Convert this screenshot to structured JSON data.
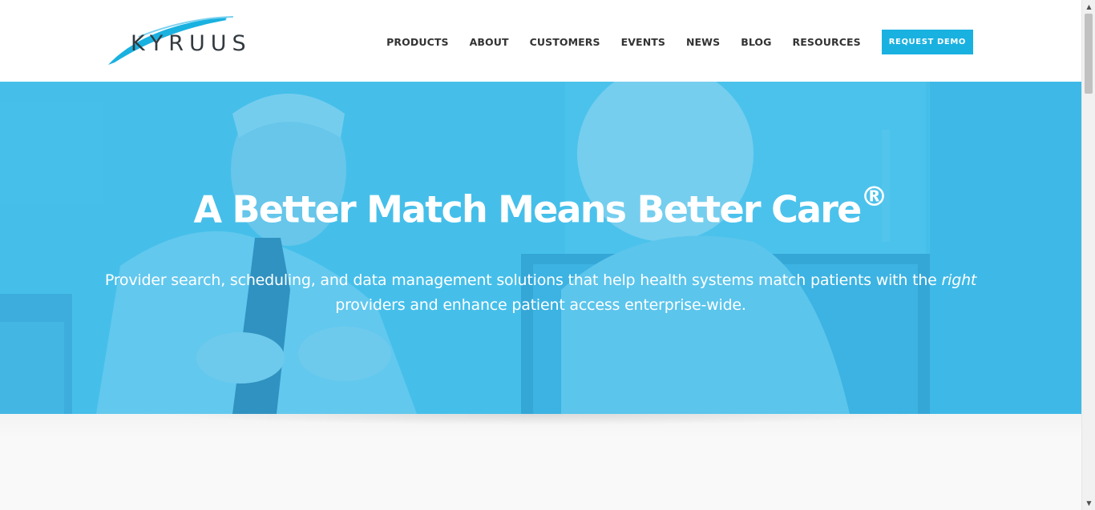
{
  "brand": {
    "name": "KYRUUS",
    "accent_color": "#19b1e0"
  },
  "nav": {
    "items": [
      "PRODUCTS",
      "ABOUT",
      "CUSTOMERS",
      "EVENTS",
      "NEWS",
      "BLOG",
      "RESOURCES"
    ],
    "cta_label": "REQUEST DEMO"
  },
  "hero": {
    "title": "A Better Match Means Better Care",
    "title_mark": "®",
    "subtitle_before": "Provider search, scheduling, and data management solutions that help health systems match patients with the ",
    "subtitle_emphasis": "right",
    "subtitle_after": " providers and enhance patient access enterprise-wide.",
    "overlay_color": "#3ebcea"
  },
  "icons": {
    "scroll_up": "scroll-up-arrow-icon",
    "scroll_down": "scroll-down-arrow-icon"
  }
}
